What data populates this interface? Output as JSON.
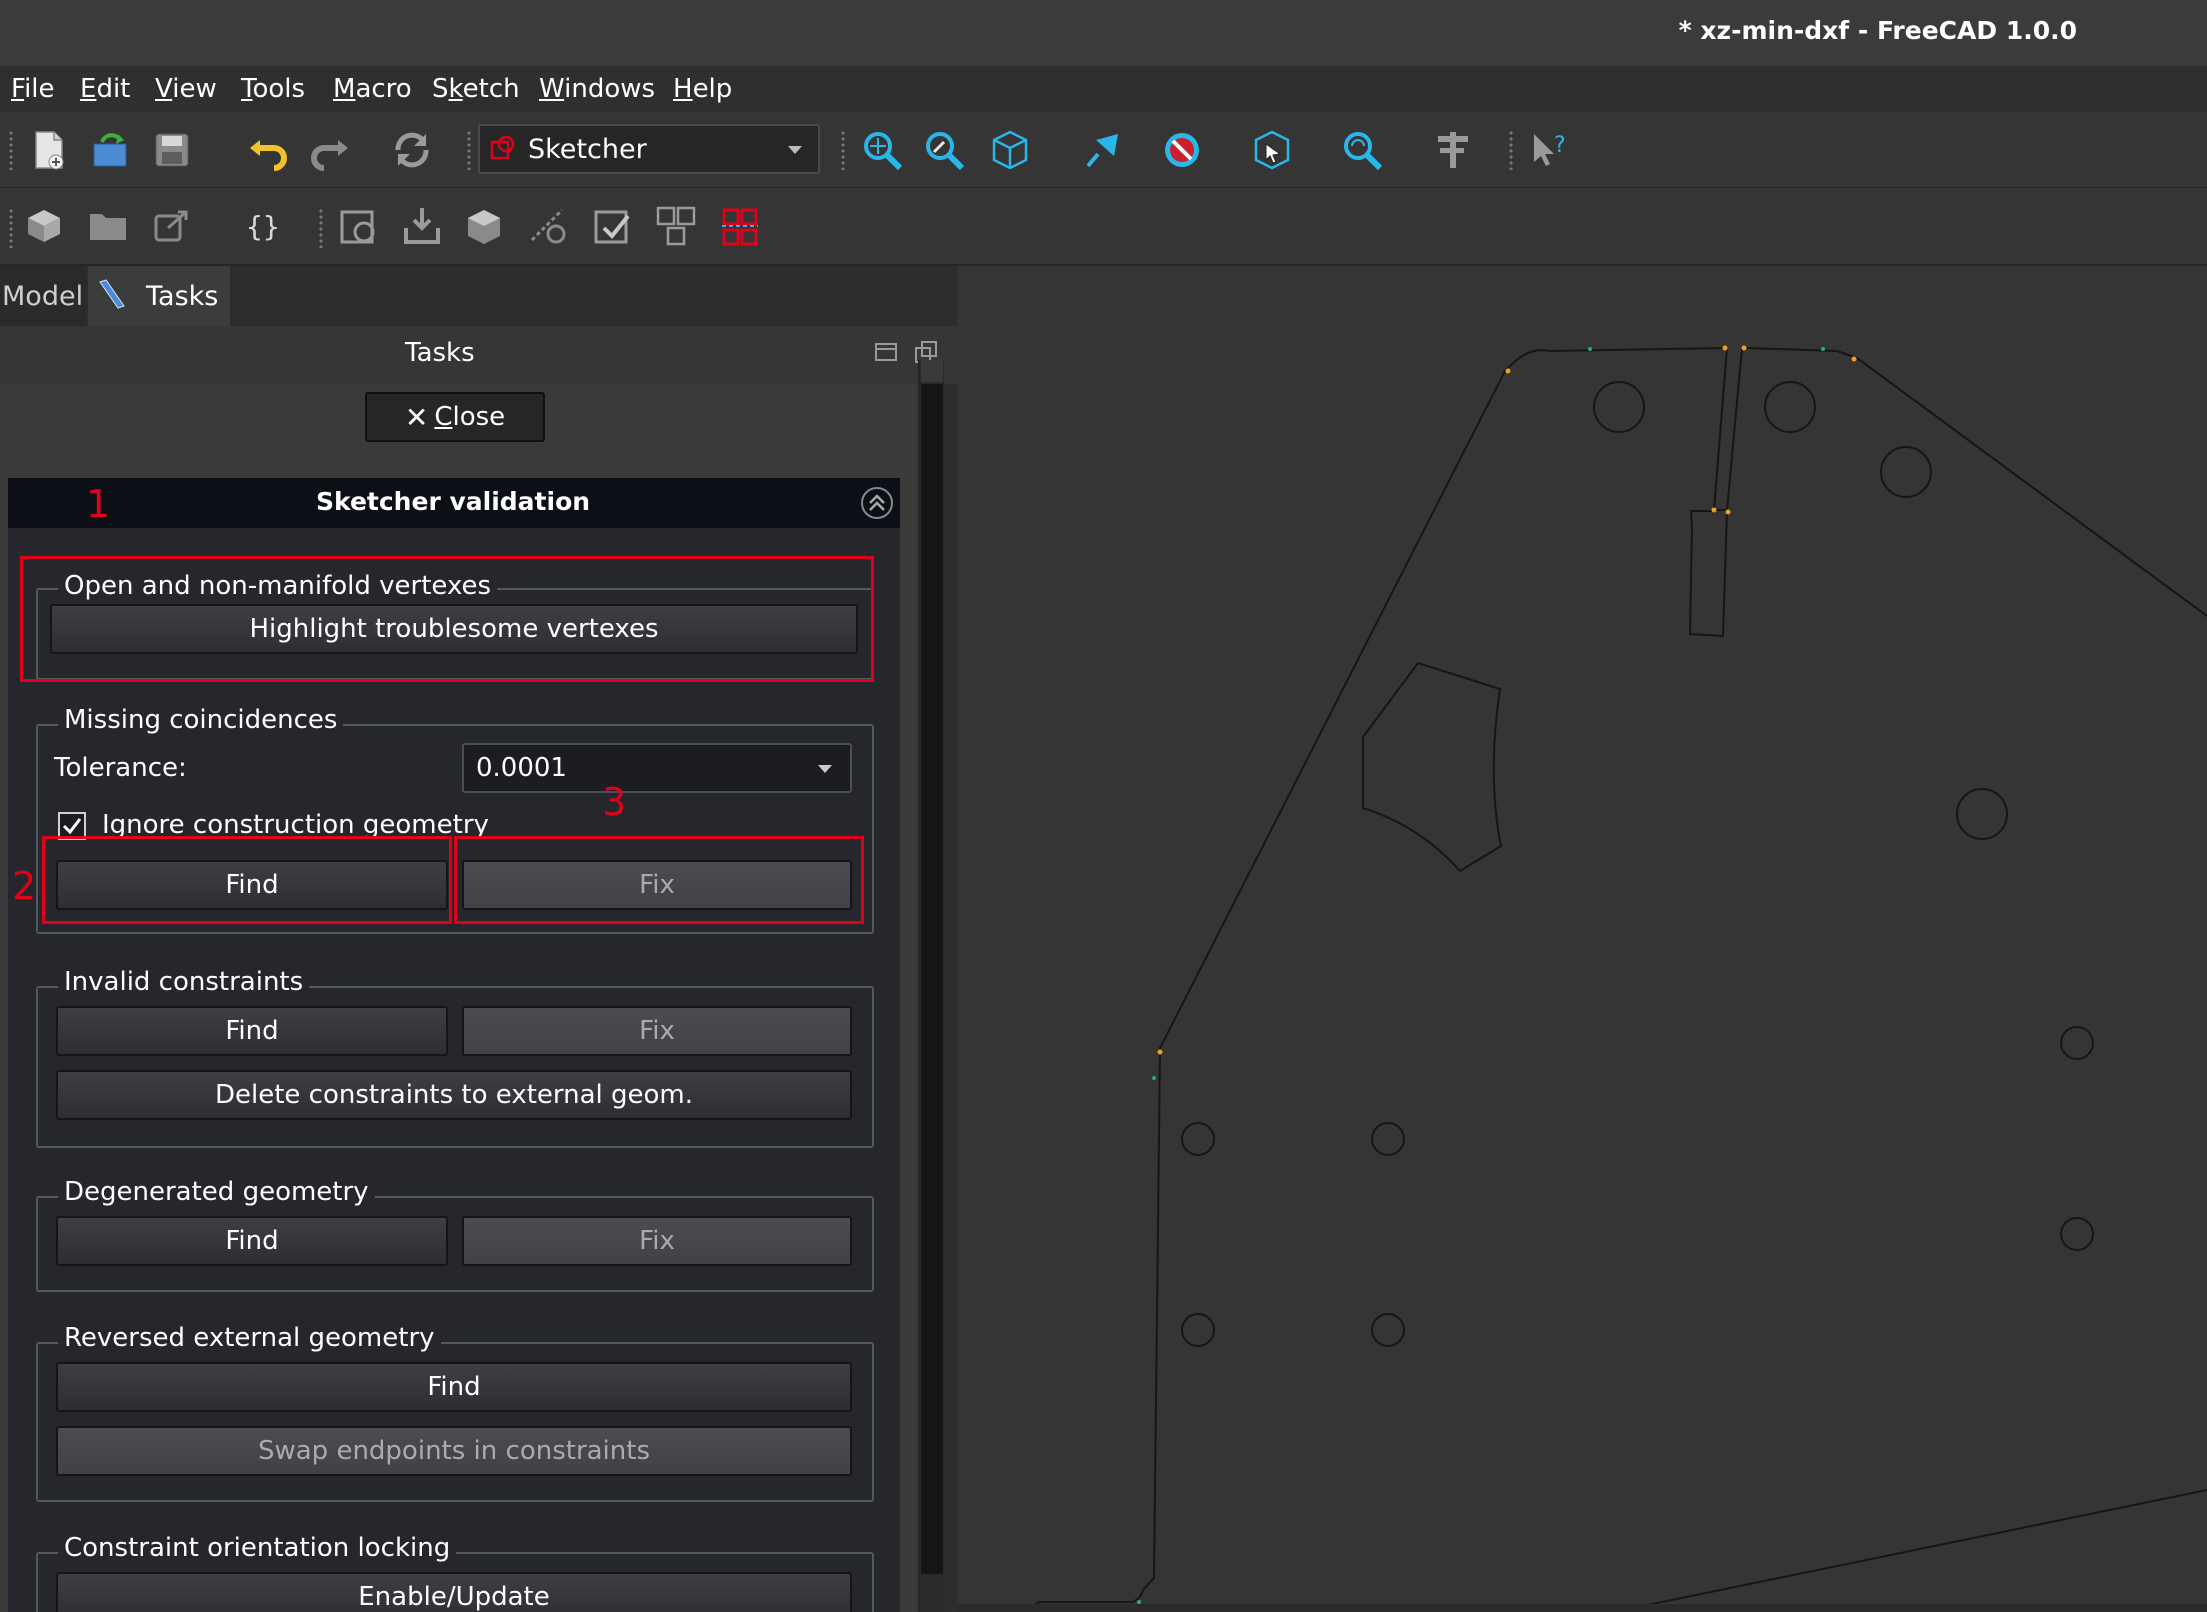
{
  "window": {
    "title": "* xz-min-dxf - FreeCAD 1.0.0"
  },
  "menu": [
    {
      "pre": "",
      "u": "F",
      "post": "ile"
    },
    {
      "pre": "",
      "u": "E",
      "post": "dit"
    },
    {
      "pre": "",
      "u": "V",
      "post": "iew"
    },
    {
      "pre": "",
      "u": "T",
      "post": "ools"
    },
    {
      "pre": "",
      "u": "M",
      "post": "acro"
    },
    {
      "pre": "S",
      "u": "k",
      "post": "etch"
    },
    {
      "pre": "",
      "u": "W",
      "post": "indows"
    },
    {
      "pre": "",
      "u": "H",
      "post": "elp"
    }
  ],
  "toolbar": {
    "workbench": "Sketcher"
  },
  "tabs": {
    "model": "Model",
    "tasks": "Tasks"
  },
  "tasks_panel": {
    "title": "Tasks",
    "close_icon": "✕",
    "close_u": "C",
    "close_rest": "lose"
  },
  "validation": {
    "title": "Sketcher validation",
    "open_vertexes": {
      "title": "Open and non-manifold vertexes",
      "highlight_button": "Highlight troublesome vertexes"
    },
    "missing_coincidences": {
      "title": "Missing coincidences",
      "tolerance_label": "Tolerance:",
      "tolerance_value": "0.0001",
      "ignore_construction": "Ignore construction geometry",
      "ignore_checked": true,
      "find_button": "Find",
      "fix_button": "Fix"
    },
    "invalid_constraints": {
      "title": "Invalid constraints",
      "find_button": "Find",
      "fix_button": "Fix",
      "delete_button": "Delete constraints to external geom."
    },
    "degenerated_geometry": {
      "title": "Degenerated geometry",
      "find_button": "Find",
      "fix_button": "Fix"
    },
    "reversed_external": {
      "title": "Reversed external geometry",
      "find_button": "Find",
      "swap_button": "Swap endpoints in constraints"
    },
    "orientation_locking": {
      "title": "Constraint orientation locking",
      "enable_button": "Enable/Update"
    }
  },
  "annotations": {
    "one": "1",
    "two": "2",
    "three": "3",
    "color": "#e0001b"
  },
  "colors": {
    "accent": "#e0001b",
    "panel": "#25272d"
  }
}
